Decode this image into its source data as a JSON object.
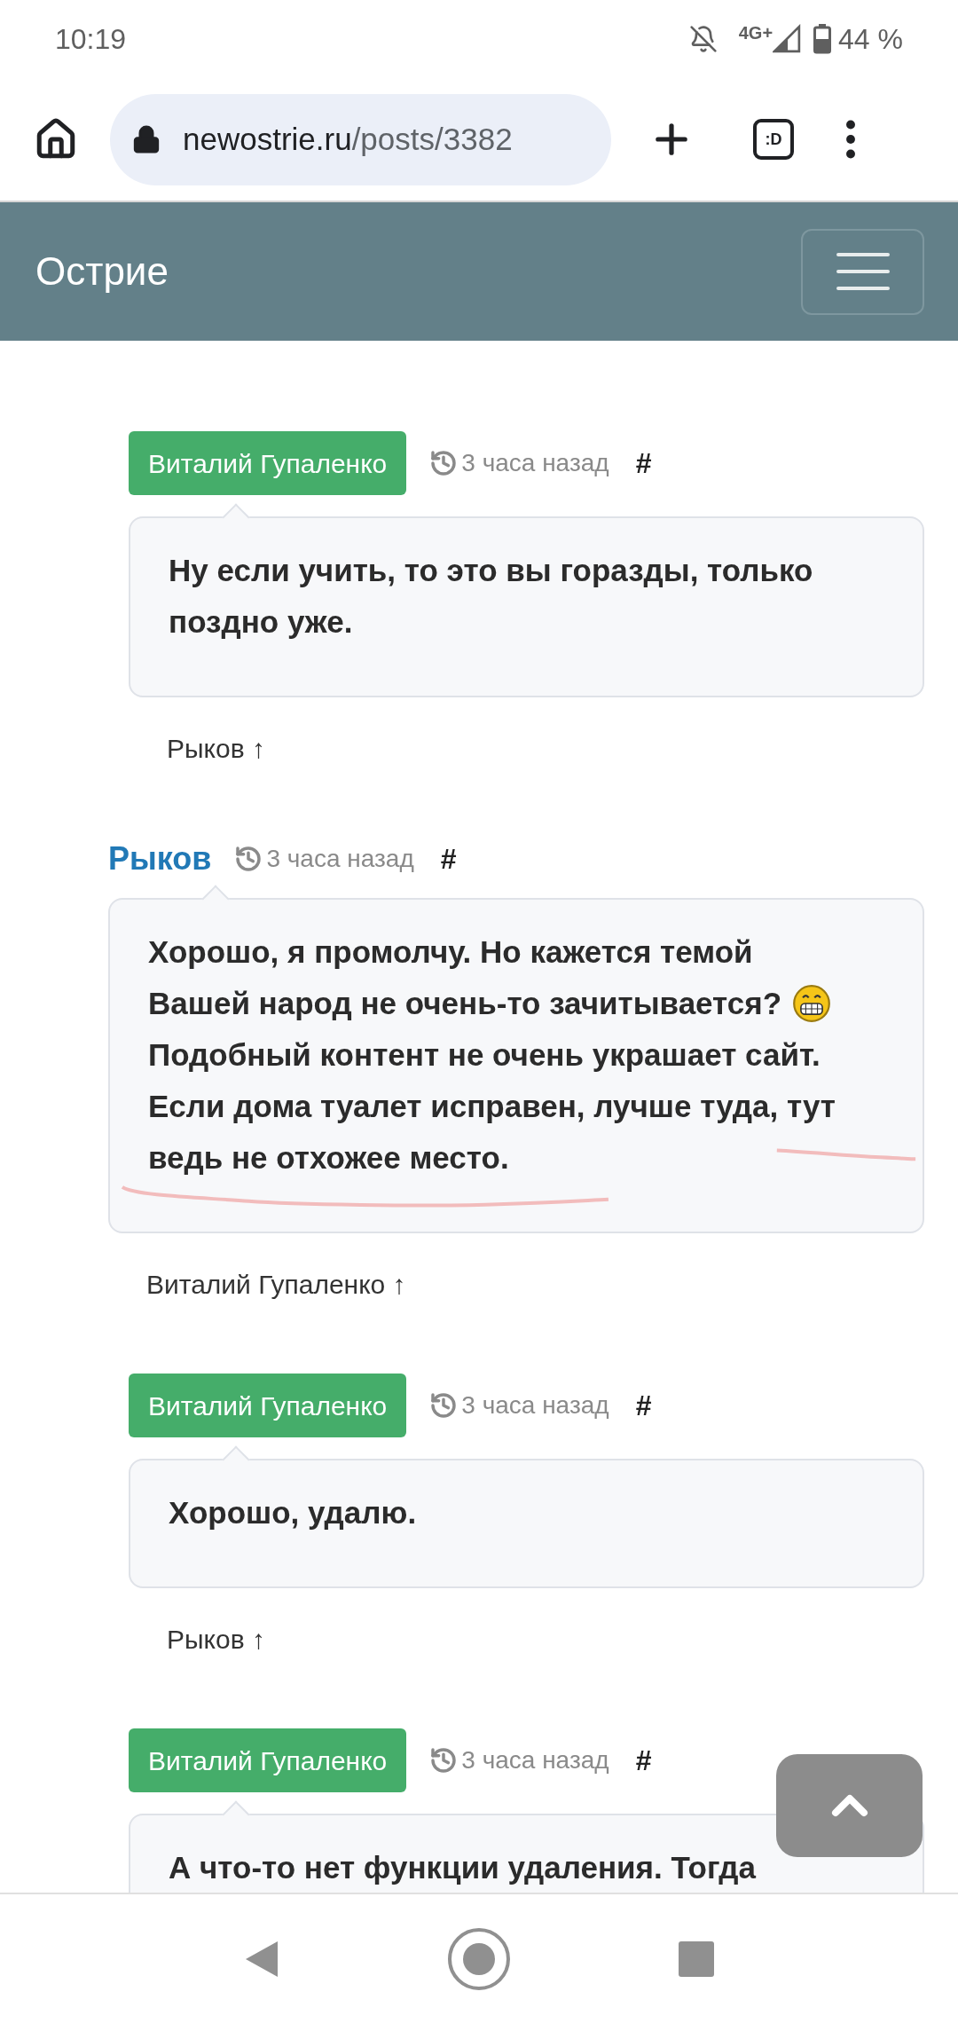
{
  "status_bar": {
    "time": "10:19",
    "network": "4G+",
    "battery": "44 %"
  },
  "browser": {
    "url_host": "newostrie.ru",
    "url_path": "/posts/3382",
    "tab_switcher": ":D"
  },
  "site": {
    "title": "Острие"
  },
  "comments": [
    {
      "author": "Виталий Гупаленко",
      "kind": "badge",
      "time": "3 часа назад",
      "anchor": "#",
      "lines": [
        {
          "kind": "text",
          "text": "Ну если учить, то это вы горазды, только"
        },
        {
          "kind": "text",
          "text": "поздно уже."
        }
      ],
      "reply_link": "Рыков ↑"
    },
    {
      "author": "Рыков",
      "kind": "link",
      "time": "3 часа назад",
      "anchor": "#",
      "lines": [
        {
          "kind": "text",
          "text": "Хорошо, я промолчу. Но кажется темой"
        },
        {
          "kind": "text_emoji",
          "text": "Вашей народ не очень-то зачитывается?"
        },
        {
          "kind": "text",
          "text": "Подобный контент не очень украшает сайт."
        },
        {
          "kind": "text",
          "text": "Если дома туалет исправен, лучше туда, тут"
        },
        {
          "kind": "text",
          "text": "ведь не отхожее место."
        }
      ],
      "pen_marks": true,
      "reply_link": "Виталий Гупаленко ↑"
    },
    {
      "author": "Виталий Гупаленко",
      "kind": "badge",
      "time": "3 часа назад",
      "anchor": "#",
      "lines": [
        {
          "kind": "text",
          "text": "Хорошо, удалю."
        }
      ],
      "reply_link": "Рыков ↑"
    },
    {
      "author": "Виталий Гупаленко",
      "kind": "badge",
      "time": "3 часа назад",
      "anchor": "#",
      "lines": [
        {
          "kind": "text",
          "text": "А что-то нет функции удаления. Тогда"
        }
      ]
    }
  ]
}
